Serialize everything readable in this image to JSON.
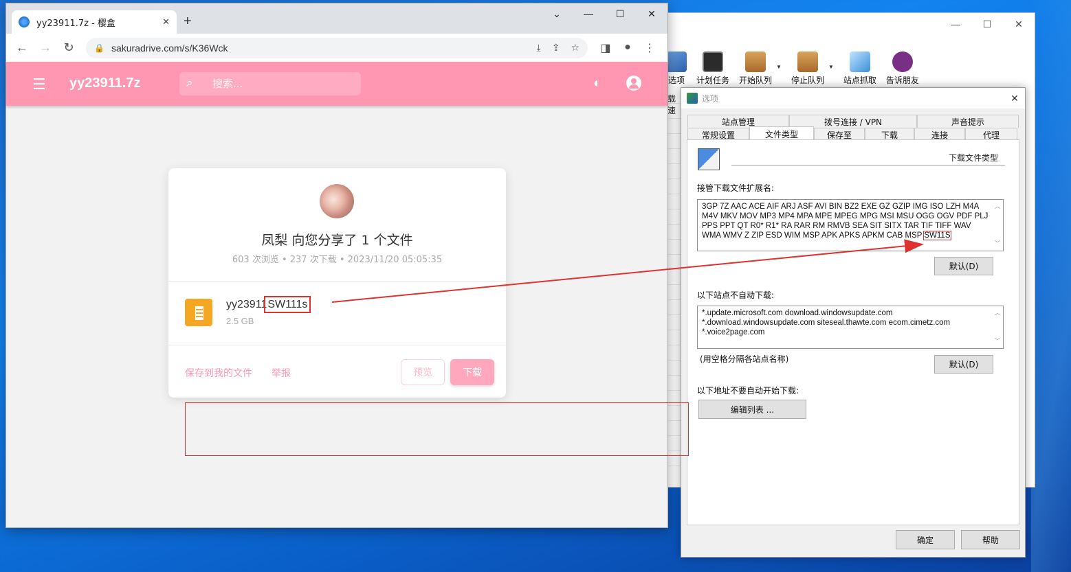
{
  "accent_pink": "#ff96b2",
  "annotation_red": "#e03131",
  "idm": {
    "toolbar": [
      {
        "label": "选项",
        "icon": "wrench-icon"
      },
      {
        "label": "计划任务",
        "icon": "monitor-icon"
      },
      {
        "label": "开始队列",
        "icon": "box-start-icon"
      },
      {
        "label": "停止队列",
        "icon": "box-stop-icon"
      },
      {
        "label": "站点抓取",
        "icon": "cursor-icon"
      },
      {
        "label": "告诉朋友",
        "icon": "friend-icon"
      }
    ],
    "side_label": "载速"
  },
  "dialog": {
    "title": "选项",
    "tabs_top": [
      "站点管理",
      "拨号连接 / VPN",
      "声音提示"
    ],
    "tabs_bottom": [
      "常规设置",
      "文件类型",
      "保存至",
      "下载",
      "连接",
      "代理"
    ],
    "active_tab": "文件类型",
    "section_title": "下载文件类型",
    "ext_label": "接管下载文件扩展名:",
    "ext_text": "3GP 7Z AAC ACE AIF ARJ ASF AVI BIN BZ2 EXE GZ GZIP IMG ISO LZH M4A M4V MKV MOV MP3 MP4 MPA MPE MPEG MPG MSI MSU OGG OGV PDF PLJ PPS PPT QT R0* R1* RA RAR RM RMVB SEA SIT SITX TAR TIF TIFF WAV WMA WMV Z ZIP ESD WIM MSP APK APKS APKM CAB MSP",
    "ext_highlight": "SW11S",
    "default_btn": "默认(D)",
    "sites_label": "以下站点不自动下载:",
    "sites_lines": [
      "*.update.microsoft.com download.windowsupdate.com",
      "*.download.windowsupdate.com siteseal.thawte.com ecom.cimetz.com",
      "*.voice2page.com"
    ],
    "sites_hint": "(用空格分隔各站点名称)",
    "addr_label": "以下地址不要自动开始下载:",
    "edit_btn": "编辑列表 ...",
    "ok_btn": "确定",
    "help_btn": "帮助"
  },
  "chrome": {
    "tab_title": "yy23911.7z - 樱盒",
    "url": "sakuradrive.com/s/K36Wck"
  },
  "site": {
    "title": "yy23911.7z",
    "search_placeholder": "搜索...",
    "share_title": "凤梨 向您分享了 1 个文件",
    "share_meta": "603 次浏览 • 237 次下载 • 2023/11/20 05:05:35",
    "file_name_base": "yy23911",
    "file_name_ext": "SW111s",
    "file_size": "2.5 GB",
    "save_link": "保存到我的文件",
    "report_link": "举报",
    "preview_btn": "预览",
    "download_btn": "下载"
  }
}
